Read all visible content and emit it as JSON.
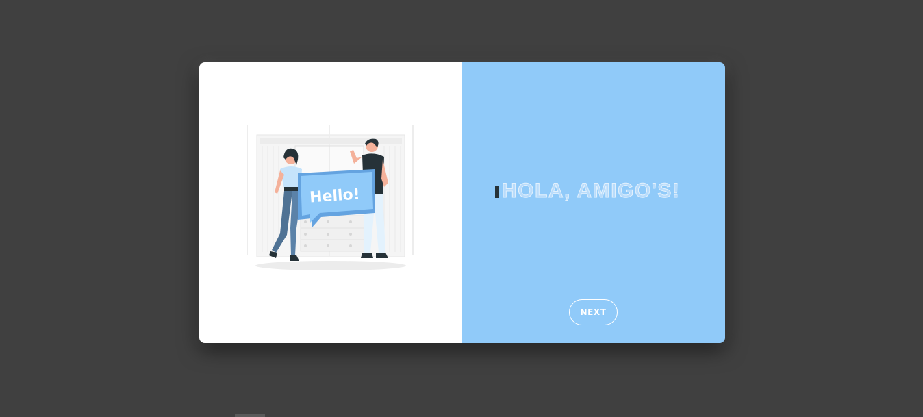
{
  "colors": {
    "backdrop": "#404040",
    "left_panel": "#ffffff",
    "right_panel": "#90caf9",
    "accent": "#90caf9",
    "cursor": "#263238"
  },
  "illustration": {
    "icon": "hello-greeting-illustration",
    "sign_text": "Hello!"
  },
  "greeting": {
    "text": "HOLA, AMIGO'S!"
  },
  "next_button": {
    "label": "NEXT"
  }
}
